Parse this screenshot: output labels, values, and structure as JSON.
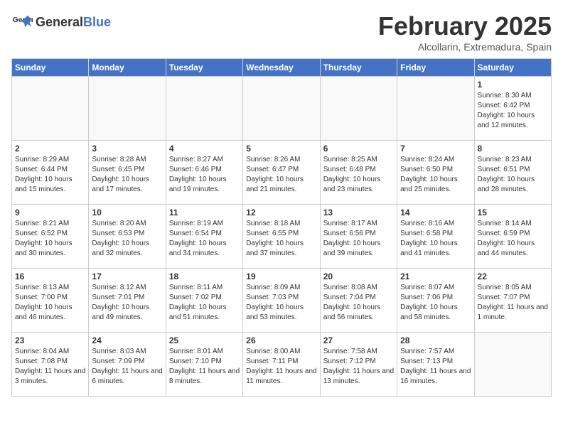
{
  "header": {
    "logo_general": "General",
    "logo_blue": "Blue",
    "title": "February 2025",
    "subtitle": "Alcollarin, Extremadura, Spain"
  },
  "days_of_week": [
    "Sunday",
    "Monday",
    "Tuesday",
    "Wednesday",
    "Thursday",
    "Friday",
    "Saturday"
  ],
  "weeks": [
    [
      {
        "day": "",
        "info": ""
      },
      {
        "day": "",
        "info": ""
      },
      {
        "day": "",
        "info": ""
      },
      {
        "day": "",
        "info": ""
      },
      {
        "day": "",
        "info": ""
      },
      {
        "day": "",
        "info": ""
      },
      {
        "day": "1",
        "info": "Sunrise: 8:30 AM\nSunset: 6:42 PM\nDaylight: 10 hours and 12 minutes."
      }
    ],
    [
      {
        "day": "2",
        "info": "Sunrise: 8:29 AM\nSunset: 6:44 PM\nDaylight: 10 hours and 15 minutes."
      },
      {
        "day": "3",
        "info": "Sunrise: 8:28 AM\nSunset: 6:45 PM\nDaylight: 10 hours and 17 minutes."
      },
      {
        "day": "4",
        "info": "Sunrise: 8:27 AM\nSunset: 6:46 PM\nDaylight: 10 hours and 19 minutes."
      },
      {
        "day": "5",
        "info": "Sunrise: 8:26 AM\nSunset: 6:47 PM\nDaylight: 10 hours and 21 minutes."
      },
      {
        "day": "6",
        "info": "Sunrise: 8:25 AM\nSunset: 6:48 PM\nDaylight: 10 hours and 23 minutes."
      },
      {
        "day": "7",
        "info": "Sunrise: 8:24 AM\nSunset: 6:50 PM\nDaylight: 10 hours and 25 minutes."
      },
      {
        "day": "8",
        "info": "Sunrise: 8:23 AM\nSunset: 6:51 PM\nDaylight: 10 hours and 28 minutes."
      }
    ],
    [
      {
        "day": "9",
        "info": "Sunrise: 8:21 AM\nSunset: 6:52 PM\nDaylight: 10 hours and 30 minutes."
      },
      {
        "day": "10",
        "info": "Sunrise: 8:20 AM\nSunset: 6:53 PM\nDaylight: 10 hours and 32 minutes."
      },
      {
        "day": "11",
        "info": "Sunrise: 8:19 AM\nSunset: 6:54 PM\nDaylight: 10 hours and 34 minutes."
      },
      {
        "day": "12",
        "info": "Sunrise: 8:18 AM\nSunset: 6:55 PM\nDaylight: 10 hours and 37 minutes."
      },
      {
        "day": "13",
        "info": "Sunrise: 8:17 AM\nSunset: 6:56 PM\nDaylight: 10 hours and 39 minutes."
      },
      {
        "day": "14",
        "info": "Sunrise: 8:16 AM\nSunset: 6:58 PM\nDaylight: 10 hours and 41 minutes."
      },
      {
        "day": "15",
        "info": "Sunrise: 8:14 AM\nSunset: 6:59 PM\nDaylight: 10 hours and 44 minutes."
      }
    ],
    [
      {
        "day": "16",
        "info": "Sunrise: 8:13 AM\nSunset: 7:00 PM\nDaylight: 10 hours and 46 minutes."
      },
      {
        "day": "17",
        "info": "Sunrise: 8:12 AM\nSunset: 7:01 PM\nDaylight: 10 hours and 49 minutes."
      },
      {
        "day": "18",
        "info": "Sunrise: 8:11 AM\nSunset: 7:02 PM\nDaylight: 10 hours and 51 minutes."
      },
      {
        "day": "19",
        "info": "Sunrise: 8:09 AM\nSunset: 7:03 PM\nDaylight: 10 hours and 53 minutes."
      },
      {
        "day": "20",
        "info": "Sunrise: 8:08 AM\nSunset: 7:04 PM\nDaylight: 10 hours and 56 minutes."
      },
      {
        "day": "21",
        "info": "Sunrise: 8:07 AM\nSunset: 7:06 PM\nDaylight: 10 hours and 58 minutes."
      },
      {
        "day": "22",
        "info": "Sunrise: 8:05 AM\nSunset: 7:07 PM\nDaylight: 11 hours and 1 minute."
      }
    ],
    [
      {
        "day": "23",
        "info": "Sunrise: 8:04 AM\nSunset: 7:08 PM\nDaylight: 11 hours and 3 minutes."
      },
      {
        "day": "24",
        "info": "Sunrise: 8:03 AM\nSunset: 7:09 PM\nDaylight: 11 hours and 6 minutes."
      },
      {
        "day": "25",
        "info": "Sunrise: 8:01 AM\nSunset: 7:10 PM\nDaylight: 11 hours and 8 minutes."
      },
      {
        "day": "26",
        "info": "Sunrise: 8:00 AM\nSunset: 7:11 PM\nDaylight: 11 hours and 11 minutes."
      },
      {
        "day": "27",
        "info": "Sunrise: 7:58 AM\nSunset: 7:12 PM\nDaylight: 11 hours and 13 minutes."
      },
      {
        "day": "28",
        "info": "Sunrise: 7:57 AM\nSunset: 7:13 PM\nDaylight: 11 hours and 16 minutes."
      },
      {
        "day": "",
        "info": ""
      }
    ]
  ]
}
